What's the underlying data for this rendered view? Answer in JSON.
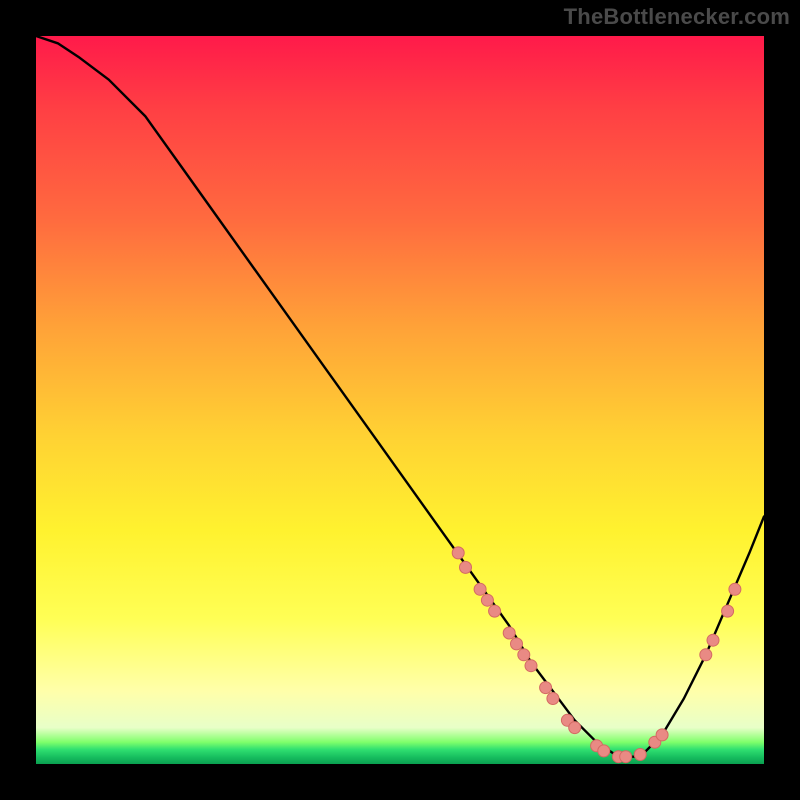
{
  "attribution": "TheBottlenecker.com",
  "chart_data": {
    "type": "line",
    "title": "",
    "xlabel": "",
    "ylabel": "",
    "xlim": [
      0,
      100
    ],
    "ylim": [
      0,
      100
    ],
    "series": [
      {
        "name": "curve",
        "x": [
          0,
          3,
          6,
          10,
          15,
          20,
          25,
          30,
          35,
          40,
          45,
          50,
          55,
          60,
          65,
          68,
          71,
          74,
          77,
          80,
          83,
          86,
          89,
          92,
          95,
          98,
          100
        ],
        "y": [
          100,
          99,
          97,
          94,
          89,
          82,
          75,
          68,
          61,
          54,
          47,
          40,
          33,
          26,
          19,
          14,
          10,
          6,
          3,
          1,
          1,
          4,
          9,
          15,
          22,
          29,
          34
        ]
      }
    ],
    "markers": [
      {
        "x": 58,
        "y": 29
      },
      {
        "x": 59,
        "y": 27
      },
      {
        "x": 61,
        "y": 24
      },
      {
        "x": 62,
        "y": 22.5
      },
      {
        "x": 63,
        "y": 21
      },
      {
        "x": 65,
        "y": 18
      },
      {
        "x": 66,
        "y": 16.5
      },
      {
        "x": 67,
        "y": 15
      },
      {
        "x": 68,
        "y": 13.5
      },
      {
        "x": 70,
        "y": 10.5
      },
      {
        "x": 71,
        "y": 9
      },
      {
        "x": 73,
        "y": 6
      },
      {
        "x": 74,
        "y": 5
      },
      {
        "x": 77,
        "y": 2.5
      },
      {
        "x": 78,
        "y": 1.8
      },
      {
        "x": 80,
        "y": 1
      },
      {
        "x": 81,
        "y": 1
      },
      {
        "x": 83,
        "y": 1.3
      },
      {
        "x": 85,
        "y": 3
      },
      {
        "x": 86,
        "y": 4
      },
      {
        "x": 92,
        "y": 15
      },
      {
        "x": 93,
        "y": 17
      },
      {
        "x": 95,
        "y": 21
      },
      {
        "x": 96,
        "y": 24
      }
    ],
    "colors": {
      "curve": "#000000",
      "marker_fill": "#e98a84",
      "marker_stroke": "#d46a63"
    }
  }
}
